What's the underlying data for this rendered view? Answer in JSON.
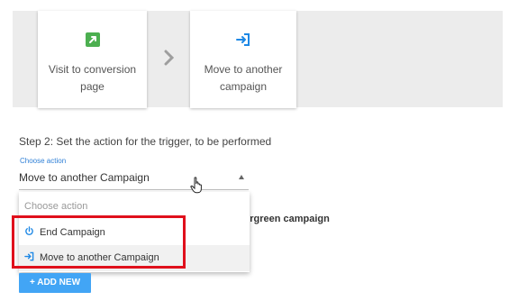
{
  "flow": {
    "cards": [
      {
        "label": "Visit to conversion page",
        "icon": "external-link-icon",
        "icon_color": "#4caf50"
      },
      {
        "label": "Move to another campaign",
        "icon": "sign-in-icon",
        "icon_color": "#1e88e5"
      }
    ]
  },
  "step": {
    "label": "Step 2: Set the action for the trigger, to be performed"
  },
  "select": {
    "caption": "Choose action",
    "value": "Move to another Campaign"
  },
  "dropdown": {
    "placeholder": "Choose action",
    "items": [
      {
        "label": "End Campaign",
        "icon": "power-icon"
      },
      {
        "label": "Move to another Campaign",
        "icon": "sign-in-icon"
      }
    ]
  },
  "behind": {
    "partial_text": "vergreen campaign"
  },
  "buttons": {
    "add_new": "+ ADD NEW"
  },
  "colors": {
    "accent": "#42a5f5",
    "highlight": "#e0101c",
    "link": "#2e7fd6"
  }
}
